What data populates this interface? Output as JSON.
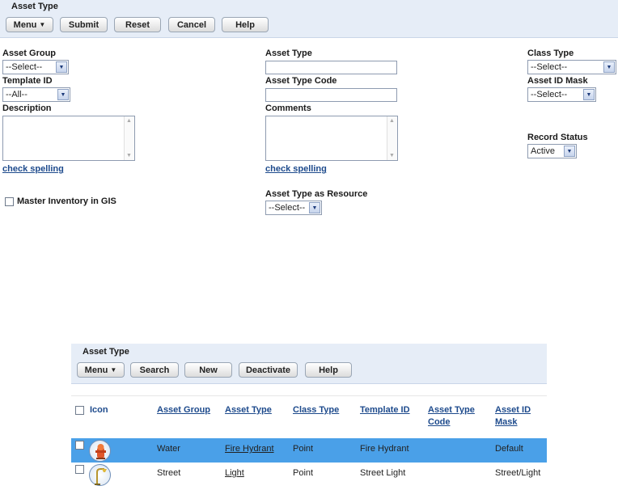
{
  "top_toolbar": {
    "title": "Asset Type",
    "buttons": {
      "menu": "Menu",
      "submit": "Submit",
      "reset": "Reset",
      "cancel": "Cancel",
      "help": "Help"
    }
  },
  "form": {
    "asset_group": {
      "label": "Asset Group",
      "value": "--Select--"
    },
    "template_id": {
      "label": "Template ID",
      "value": "--All--"
    },
    "description": {
      "label": "Description",
      "value": ""
    },
    "check_spelling_1": "check spelling",
    "master_inventory": {
      "label": "Master Inventory in GIS",
      "checked": false
    },
    "asset_type": {
      "label": "Asset Type",
      "value": ""
    },
    "asset_type_code": {
      "label": "Asset Type Code",
      "value": ""
    },
    "comments": {
      "label": "Comments",
      "value": ""
    },
    "check_spelling_2": "check spelling",
    "asset_type_as_resource": {
      "label": "Asset Type as Resource",
      "value": "--Select--"
    },
    "class_type": {
      "label": "Class Type",
      "value": "--Select--"
    },
    "asset_id_mask": {
      "label": "Asset ID Mask",
      "value": "--Select--"
    },
    "record_status": {
      "label": "Record Status",
      "value": "Active"
    }
  },
  "grid_toolbar": {
    "title": "Asset Type",
    "buttons": {
      "menu": "Menu",
      "search": "Search",
      "new": "New",
      "deactivate": "Deactivate",
      "help": "Help"
    }
  },
  "grid": {
    "columns": {
      "icon": "Icon",
      "asset_group": "Asset Group",
      "asset_type": "Asset Type",
      "class_type": "Class Type",
      "template_id": "Template ID",
      "asset_type_code_1": "Asset Type",
      "asset_type_code_2": "Code",
      "asset_id_mask_1": "Asset ID",
      "asset_id_mask_2": "Mask"
    },
    "rows": [
      {
        "icon": "fire-hydrant-icon",
        "asset_group": "Water",
        "asset_type": "Fire Hydrant",
        "class_type": "Point",
        "template_id": "Fire Hydrant",
        "asset_type_code": "",
        "asset_id_mask": "Default",
        "selected": true
      },
      {
        "icon": "street-light-icon",
        "asset_group": "Street",
        "asset_type": "Light",
        "class_type": "Point",
        "template_id": "Street Light",
        "asset_type_code": "",
        "asset_id_mask": "Street/Light",
        "selected": false
      }
    ]
  },
  "colors": {
    "toolbar_bg": "#e6edf7",
    "selected_row": "#4aa0e8",
    "link": "#1d4a8c"
  }
}
